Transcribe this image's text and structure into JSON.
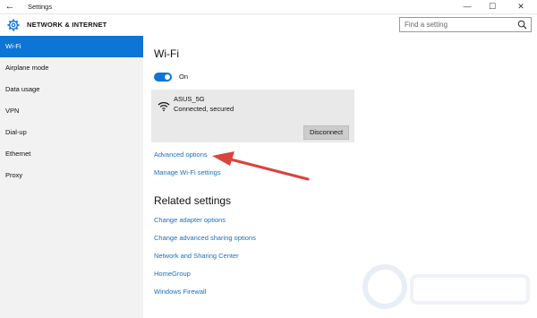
{
  "window": {
    "title": "Settings",
    "back_glyph": "←",
    "min_glyph": "—",
    "max_glyph": "☐",
    "close_glyph": "✕"
  },
  "header": {
    "title": "NETWORK & INTERNET",
    "search_placeholder": "Find a setting"
  },
  "sidebar": {
    "items": [
      {
        "label": "Wi-Fi",
        "active": true
      },
      {
        "label": "Airplane mode"
      },
      {
        "label": "Data usage"
      },
      {
        "label": "VPN"
      },
      {
        "label": "Dial-up"
      },
      {
        "label": "Ethernet"
      },
      {
        "label": "Proxy"
      }
    ]
  },
  "main": {
    "wifi_heading": "Wi-Fi",
    "toggle_label": "On",
    "network": {
      "name": "ASUS_5G",
      "status": "Connected, secured",
      "disconnect_label": "Disconnect"
    },
    "links": {
      "advanced_options": "Advanced options",
      "manage_wifi": "Manage Wi-Fi settings"
    },
    "related_heading": "Related settings",
    "related_links": [
      "Change adapter options",
      "Change advanced sharing options",
      "Network and Sharing Center",
      "HomeGroup",
      "Windows Firewall"
    ]
  },
  "colors": {
    "accent": "#0c75d6",
    "link": "#1a6fbf",
    "annotation_arrow": "#d9443b"
  }
}
